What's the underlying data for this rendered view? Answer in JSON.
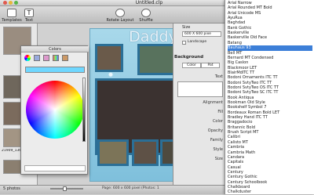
{
  "window": {
    "title": "Untitled.clp"
  },
  "toolbar": {
    "buttons": [
      {
        "label": "Templates",
        "icon": "templates-icon"
      },
      {
        "label": "Text",
        "icon": "text-icon"
      },
      {
        "label": "Rotate Layout",
        "icon": "rotate-layout-icon"
      },
      {
        "label": "Shuffle",
        "icon": "shuffle-icon"
      }
    ]
  },
  "left_panel": {
    "thumb_caption": "21909_13656..",
    "photo_count": "5 photos"
  },
  "canvas": {
    "heading": "Daddy",
    "page_info": "Page: 600 x 600 pixel (Photos: 1"
  },
  "colors_panel": {
    "title": "Colors"
  },
  "inspector": {
    "size_label": "Size",
    "size_value": "600 X 600 pixe",
    "landscape_label": "Landscape",
    "background_label": "Background",
    "tabs": [
      "Color",
      "Pat"
    ],
    "labels": [
      "Text",
      "Alignment",
      "Fill",
      "Color",
      "Opacity",
      "Family",
      "Style",
      "Size"
    ]
  },
  "font_menu": {
    "items": [
      "Arial Narrow",
      "Arial Rounded MT Bold",
      "Arial Unicode MS",
      "AyuRua",
      "Baghdad",
      "Bank Gothic",
      "Baskerville",
      "Baskerville Old Face",
      "Batang",
      "Bauhaus 93",
      "Bell MT",
      "Bernard MT Condensed",
      "Big Caslon",
      "Blackmoor LET",
      "BlairMdITC TT",
      "Bodoni Ornaments ITC TT",
      "Bodoni SvtyTwo ITC TT",
      "Bodoni SvtyTwo OS ITC TT",
      "Bodoni SvtyTwo SC ITC TT",
      "Book Antiqua",
      "Bookman Old Style",
      "Bookshelf Symbol 7",
      "Bordeaux Roman Bold LET",
      "Bradley Hand ITC TT",
      "Braggadocio",
      "Britannic Bold",
      "Brush Script MT",
      "Calibri",
      "Calisto MT",
      "Cambria",
      "Cambria Math",
      "Candara",
      "Capitals",
      "Casual",
      "Century",
      "Century Gothic",
      "Century Schoolbook",
      "Chalkboard",
      "Chalkduster"
    ],
    "selected_index": 9
  }
}
